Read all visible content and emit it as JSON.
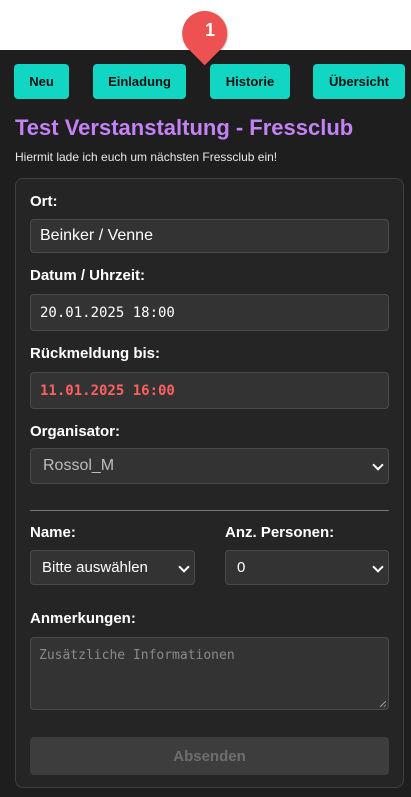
{
  "nav": {
    "neu": "Neu",
    "einladung": "Einladung",
    "historie": "Historie",
    "uebersicht": "Übersicht"
  },
  "marker": {
    "number": "1"
  },
  "header": {
    "title": "Test Verstanstaltung - Fressclub",
    "subtitle": "Hiermit lade ich euch um nächsten Fressclub ein!"
  },
  "form": {
    "ort": {
      "label": "Ort:",
      "value": "Beinker / Venne"
    },
    "datum": {
      "label": "Datum / Uhrzeit:",
      "value": "20.01.2025 18:00"
    },
    "rueckmeldung": {
      "label": "Rückmeldung bis:",
      "value": "11.01.2025 16:00"
    },
    "organisator": {
      "label": "Organisator:",
      "value": "Rossol_M"
    },
    "name": {
      "label": "Name:",
      "value": "Bitte auswählen"
    },
    "personen": {
      "label": "Anz. Personen:",
      "value": "0"
    },
    "anmerkungen": {
      "label": "Anmerkungen:",
      "placeholder": "Zusätzliche Informationen"
    },
    "submit": "Absenden"
  },
  "colors": {
    "accent": "#11d6c4",
    "title": "#c382f6",
    "deadline": "#ff6060",
    "marker": "#ee5151"
  }
}
